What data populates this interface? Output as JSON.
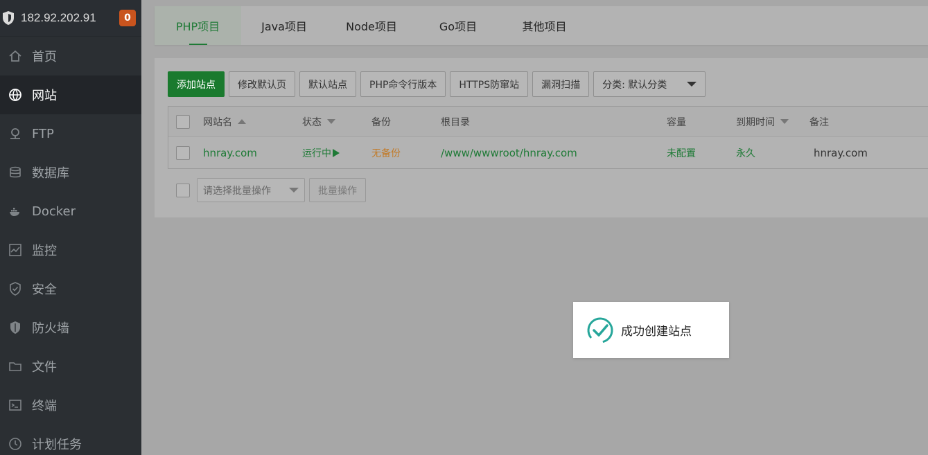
{
  "header": {
    "ip": "182.92.202.91",
    "badge": "0"
  },
  "sidebar": {
    "items": [
      {
        "label": "首页",
        "icon": "home-icon"
      },
      {
        "label": "网站",
        "icon": "globe-icon",
        "active": true
      },
      {
        "label": "FTP",
        "icon": "ftp-icon"
      },
      {
        "label": "数据库",
        "icon": "database-icon"
      },
      {
        "label": "Docker",
        "icon": "docker-icon"
      },
      {
        "label": "监控",
        "icon": "monitor-icon"
      },
      {
        "label": "安全",
        "icon": "shield-check-icon"
      },
      {
        "label": "防火墙",
        "icon": "firewall-icon"
      },
      {
        "label": "文件",
        "icon": "folder-icon"
      },
      {
        "label": "终端",
        "icon": "terminal-icon"
      },
      {
        "label": "计划任务",
        "icon": "clock-icon"
      }
    ]
  },
  "tabs": [
    {
      "label": "PHP项目",
      "active": true
    },
    {
      "label": "Java项目"
    },
    {
      "label": "Node项目"
    },
    {
      "label": "Go项目"
    },
    {
      "label": "其他项目"
    }
  ],
  "toolbar": {
    "add_site": "添加站点",
    "modify_default_page": "修改默认页",
    "default_site": "默认站点",
    "php_cli_version": "PHP命令行版本",
    "https_anti_intercept": "HTTPS防窜站",
    "vuln_scan": "漏洞扫描",
    "category": "分类: 默认分类"
  },
  "table": {
    "columns": [
      "网站名",
      "状态",
      "备份",
      "根目录",
      "容量",
      "到期时间",
      "备注"
    ],
    "rows": [
      {
        "name": "hnray.com",
        "status": "运行中",
        "backup": "无备份",
        "root": "/www/wwwroot/hnray.com",
        "capacity": "未配置",
        "expire": "永久",
        "note": "hnray.com"
      }
    ]
  },
  "batch": {
    "placeholder": "请选择批量操作",
    "button": "批量操作"
  },
  "toast": {
    "message": "成功创建站点"
  },
  "colors": {
    "accent": "#1a7a2e",
    "sidebar_bg": "#2b2f33",
    "badge": "#c9541e",
    "warning": "#c27a27"
  }
}
